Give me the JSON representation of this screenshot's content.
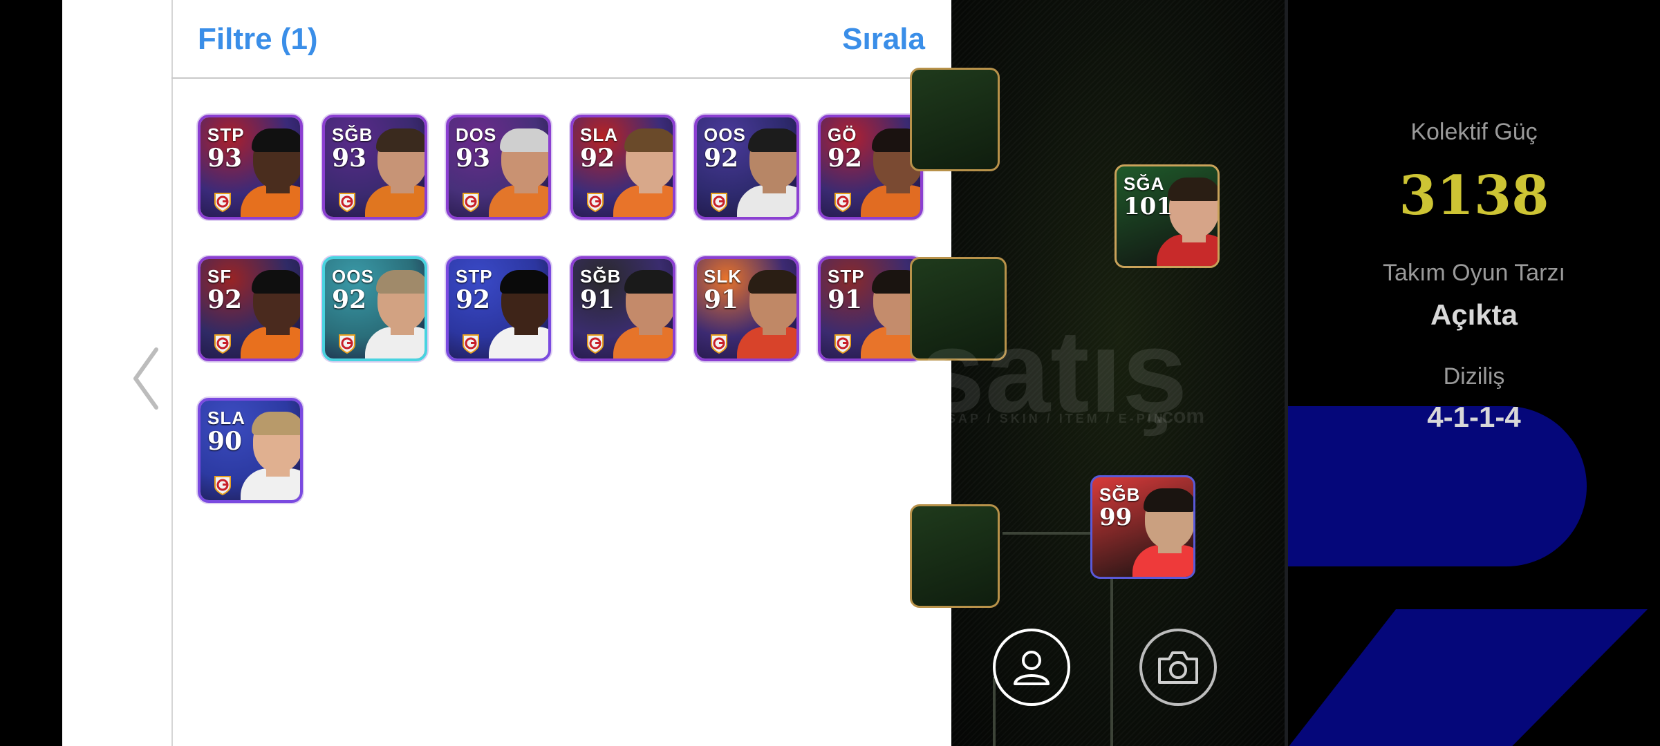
{
  "header": {
    "filter_label": "Filtre (1)",
    "sort_label": "Sırala"
  },
  "players": [
    {
      "position": "STP",
      "rating": "93",
      "bg": "#3a2a7a",
      "skin": "#4a2d1e",
      "hair": "#111111",
      "shirt": "#e6701e",
      "accent": "#ac1f2a"
    },
    {
      "position": "SĞB",
      "rating": "93",
      "bg": "#3b2a70",
      "skin": "#c79476",
      "hair": "#3a2a1e",
      "shirt": "#e07620",
      "accent": "#5a2a8a"
    },
    {
      "position": "DOS",
      "rating": "93",
      "bg": "#47307a",
      "skin": "#c99272",
      "hair": "#cfcfcf",
      "shirt": "#e3762a",
      "accent": "#6a2a8a"
    },
    {
      "position": "SLA",
      "rating": "92",
      "bg": "#3c2c7a",
      "skin": "#d8a88a",
      "hair": "#6a4a2a",
      "shirt": "#e8742a",
      "accent": "#b82222"
    },
    {
      "position": "OOS",
      "rating": "92",
      "bg": "#2e2a6e",
      "skin": "#b78666",
      "hair": "#1c1c1c",
      "shirt": "#e8e8e8",
      "accent": "#4a3a9a"
    },
    {
      "position": "GÖ",
      "rating": "92",
      "bg": "#3a2a72",
      "skin": "#7a4a32",
      "hair": "#1a1210",
      "shirt": "#e16c22",
      "accent": "#b02030"
    },
    {
      "position": "SF",
      "rating": "92",
      "bg": "#2f2a66",
      "skin": "#4a2a1e",
      "hair": "#0f0f0f",
      "shirt": "#e8701e",
      "accent": "#9a2424"
    },
    {
      "position": "OOS",
      "rating": "92",
      "bg": "#2a6e7a",
      "skin": "#d2a282",
      "hair": "#a08a6a",
      "shirt": "#eeeeee",
      "accent": "#3a9aa8"
    },
    {
      "position": "STP",
      "rating": "92",
      "bg": "#2c36a0",
      "skin": "#3e2418",
      "hair": "#0a0a0a",
      "shirt": "#f2f2f2",
      "accent": "#3a4ac8"
    },
    {
      "position": "SĞB",
      "rating": "91",
      "bg": "#3a2c6e",
      "skin": "#c48a6a",
      "hair": "#1a1a1a",
      "shirt": "#e6742a",
      "accent": "#2a2a2a"
    },
    {
      "position": "SLK",
      "rating": "91",
      "bg": "#3c2a72",
      "skin": "#c08866",
      "hair": "#2a1e14",
      "shirt": "#d8432a",
      "accent": "#e8742a"
    },
    {
      "position": "STP",
      "rating": "91",
      "bg": "#3b2b70",
      "skin": "#c48c6c",
      "hair": "#1a1410",
      "shirt": "#e8742a",
      "accent": "#8a2a2a"
    },
    {
      "position": "SLA",
      "rating": "90",
      "bg": "#2c3aa2",
      "skin": "#e0b090",
      "hair": "#b89a6a",
      "shirt": "#f0f0f0",
      "accent": "#3c4cc0"
    }
  ],
  "pitch_cards": [
    {
      "position": "SĞA",
      "rating": "101",
      "frame": "#c9a25a",
      "bg": "#1f5a2a",
      "skin": "#d6a488",
      "hair": "#2a1e14",
      "shirt": "#c82a2a"
    },
    {
      "position": "SĞB",
      "rating": "99",
      "frame": "#5a5ad8",
      "bg": "#d83a3a",
      "skin": "#caa080",
      "hair": "#1a1410",
      "shirt": "#ee3a3a"
    }
  ],
  "side_panel": {
    "power_label": "Kolektif Güç",
    "power_value": "3138",
    "style_label": "Takım Oyun Tarzı",
    "style_value": "Açıkta",
    "formation_label": "Diziliş",
    "formation_value": "4-1-1-4"
  },
  "watermark": {
    "main": "satış",
    "sub": "SAP / SKIN / ITEM / E-PIN",
    "domain": ".com"
  },
  "icons": {
    "back": "chevron-left-icon",
    "profile": "person-icon",
    "camera": "camera-icon",
    "club": "galatasaray-badge-icon"
  },
  "colors": {
    "accent_blue": "#3a8ee8",
    "power_gold": "#cdc434",
    "card_frame": "#8b3fd1"
  }
}
